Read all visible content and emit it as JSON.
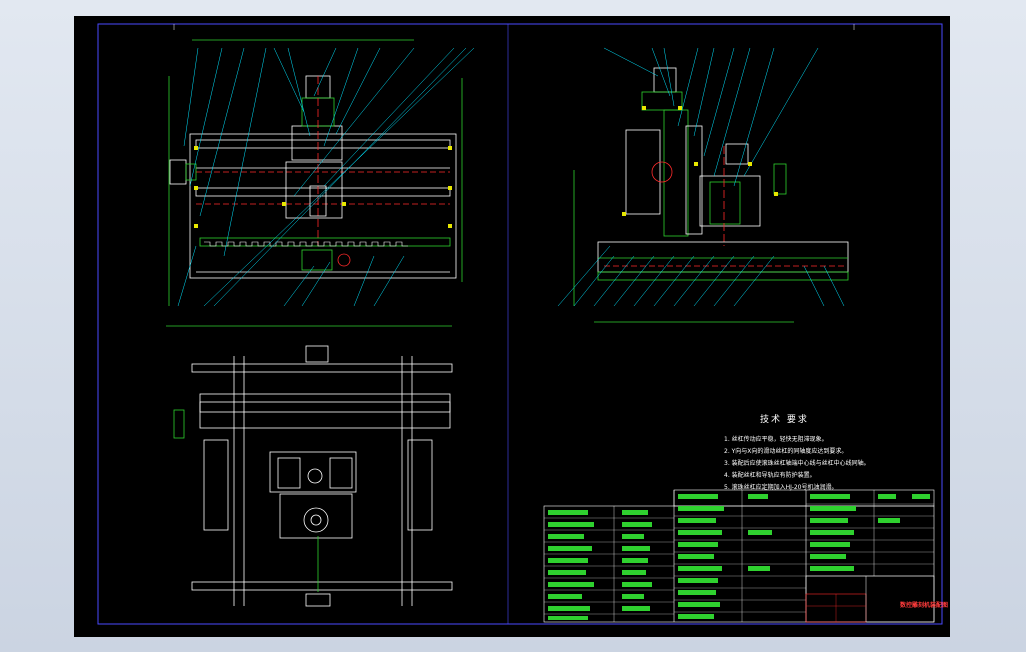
{
  "drawing": {
    "technical_requirements": {
      "title": "技术 要求",
      "items": [
        "1. 丝杠传动应平稳，轻快无阻滞现象。",
        "2. Y向与X向的滑动丝杠的同轴度应达到要求。",
        "3. 装配后应使滚珠丝杠轴端中心线与丝杠中心线同轴。",
        "4. 装配丝杠和导轨应有防护装置。",
        "5. 滚珠丝杠应定期加入HJ-20号机油润滑。"
      ]
    },
    "title_block": {
      "title": "数控雕刻机装配图"
    }
  },
  "colors": {
    "background": "#000000",
    "frame_blue": "#4A4AFF",
    "outline_white": "#FFFFFF",
    "dimension_green": "#2FD12F",
    "accent_red": "#FF2A2A",
    "accent_cyan": "#00E5FF",
    "accent_yellow": "#E8E800"
  }
}
